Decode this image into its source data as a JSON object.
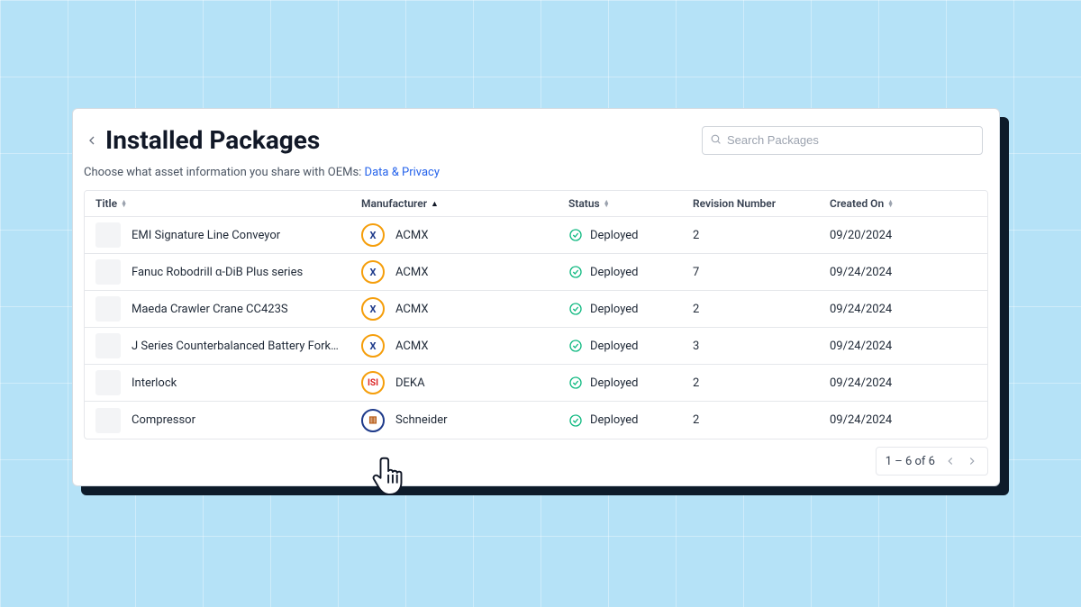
{
  "header": {
    "title": "Installed Packages",
    "search_placeholder": "Search Packages"
  },
  "subtitle": {
    "prefix": "Choose what asset information you share with OEMs: ",
    "link_text": "Data & Privacy"
  },
  "columns": {
    "title": "Title",
    "manufacturer": "Manufacturer",
    "status": "Status",
    "revision": "Revision Number",
    "created": "Created On"
  },
  "rows": [
    {
      "title": "EMI Signature Line Conveyor",
      "mfr": "ACMX",
      "mfr_logo": "acmx",
      "status": "Deployed",
      "rev": "2",
      "created": "09/20/2024"
    },
    {
      "title": "Fanuc Robodrill α-DiB Plus series",
      "mfr": "ACMX",
      "mfr_logo": "acmx",
      "status": "Deployed",
      "rev": "7",
      "created": "09/24/2024"
    },
    {
      "title": "Maeda Crawler Crane CC423S",
      "mfr": "ACMX",
      "mfr_logo": "acmx",
      "status": "Deployed",
      "rev": "2",
      "created": "09/24/2024"
    },
    {
      "title": "J Series Counterbalanced Battery Forklift…",
      "mfr": "ACMX",
      "mfr_logo": "acmx",
      "status": "Deployed",
      "rev": "3",
      "created": "09/24/2024"
    },
    {
      "title": "Interlock",
      "mfr": "DEKA",
      "mfr_logo": "deka",
      "status": "Deployed",
      "rev": "2",
      "created": "09/24/2024"
    },
    {
      "title": "Compressor",
      "mfr": "Schneider",
      "mfr_logo": "sch",
      "status": "Deployed",
      "rev": "2",
      "created": "09/24/2024"
    }
  ],
  "logo_text": {
    "acmx": "X",
    "deka": "ISI",
    "sch": "▥"
  },
  "pagination": {
    "range": "1 – 6 of 6"
  }
}
